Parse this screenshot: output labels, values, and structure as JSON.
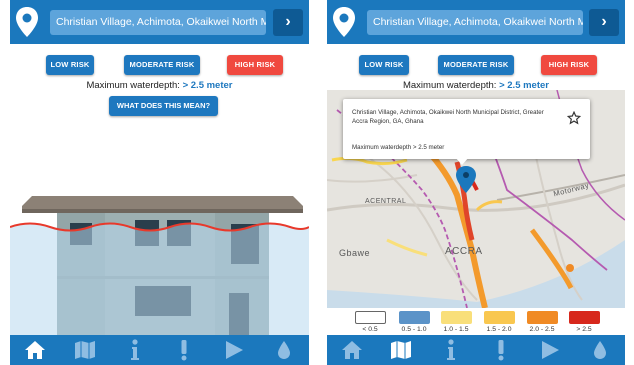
{
  "screens": [
    {
      "search": {
        "value": "Christian Village, Achimota, Okaikwei North Mu",
        "go_label": "›"
      },
      "risk_buttons": [
        "LOW RISK",
        "MODERATE RISK",
        "HIGH RISK"
      ],
      "depth_label": "Maximum waterdepth:",
      "depth_value": "> 2.5 meter",
      "info_button": "WHAT DOES THIS MEAN?",
      "nav": [
        "home-icon",
        "map-icon",
        "info-icon",
        "alert-icon",
        "play-icon",
        "water-drop-icon"
      ],
      "active_nav": "home-icon"
    },
    {
      "search": {
        "value": "Christian Village, Achimota, Okaikwei North Mu",
        "go_label": "›"
      },
      "risk_buttons": [
        "LOW RISK",
        "MODERATE RISK",
        "HIGH RISK"
      ],
      "depth_label": "Maximum waterdepth:",
      "depth_value": "> 2.5 meter",
      "popup": {
        "address": "Christian Village, Achimota, Okaikwei North Municipal District, Greater Accra Region, GA, Ghana",
        "depth": "Maximum waterdepth > 2.5 meter"
      },
      "map_labels": [
        "Gbawe",
        "ACCRA",
        "Motorway",
        "ACENTRAL"
      ],
      "legend": [
        {
          "label": "< 0.5",
          "color": "#ffffff"
        },
        {
          "label": "0.5 - 1.0",
          "color": "#5b93c8"
        },
        {
          "label": "1.0 - 1.5",
          "color": "#f9df7a"
        },
        {
          "label": "1.5 - 2.0",
          "color": "#f9c74f"
        },
        {
          "label": "2.0 - 2.5",
          "color": "#f08a24"
        },
        {
          "label": "> 2.5",
          "color": "#d7281c"
        }
      ],
      "nav": [
        "home-icon",
        "map-icon",
        "info-icon",
        "alert-icon",
        "play-icon",
        "water-drop-icon"
      ],
      "active_nav": "map-icon"
    }
  ],
  "colors": {
    "primary": "#1b78bd",
    "high_risk": "#f0493f",
    "water": "#b8d8ee",
    "flood_line": "#e8392b"
  }
}
